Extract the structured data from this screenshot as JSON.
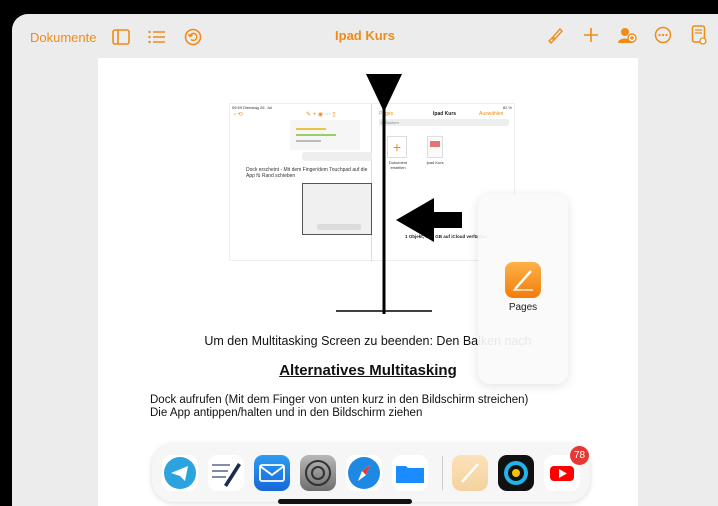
{
  "toolbar": {
    "documents_label": "Dokumente",
    "title": "Ipad Kurs"
  },
  "document": {
    "inner_screenshot": {
      "status_time": "09:59 Dienstag 26. Jul",
      "battery": "82 %",
      "back_label": "Pages",
      "title": "Ipad Kurs",
      "select_label": "Auswählen",
      "search_placeholder": "Q  Suchen",
      "tiles": [
        "Dokument erstellen",
        "Ipad Kurs"
      ],
      "caption": "Dock erscheint - Mit dem Finger/dem Touchpad auf die App fü Rand schieben",
      "storage": "1 Objekt, 76,2 GB auf iCloud verfügbar"
    },
    "multitasking_text": "Um den Multitasking Screen zu beenden: Den Balken nach",
    "section_heading": "Alternatives Multitasking",
    "body_lines": [
      "Dock aufrufen (Mit dem Finger von unten kurz in den Bildschirm streichen)",
      "Die App antippen/halten und in den Bildschirm ziehen"
    ]
  },
  "app_card": {
    "label": "Pages"
  },
  "dock": {
    "apps": [
      "telegram",
      "notes-pen",
      "mail",
      "settings",
      "safari",
      "files",
      "pages",
      "camera-app",
      "youtube"
    ],
    "youtube_badge": "78"
  },
  "colors": {
    "accent": "#ef8c17",
    "page_bg": "#ffffff",
    "screen_bg": "#ececec"
  }
}
